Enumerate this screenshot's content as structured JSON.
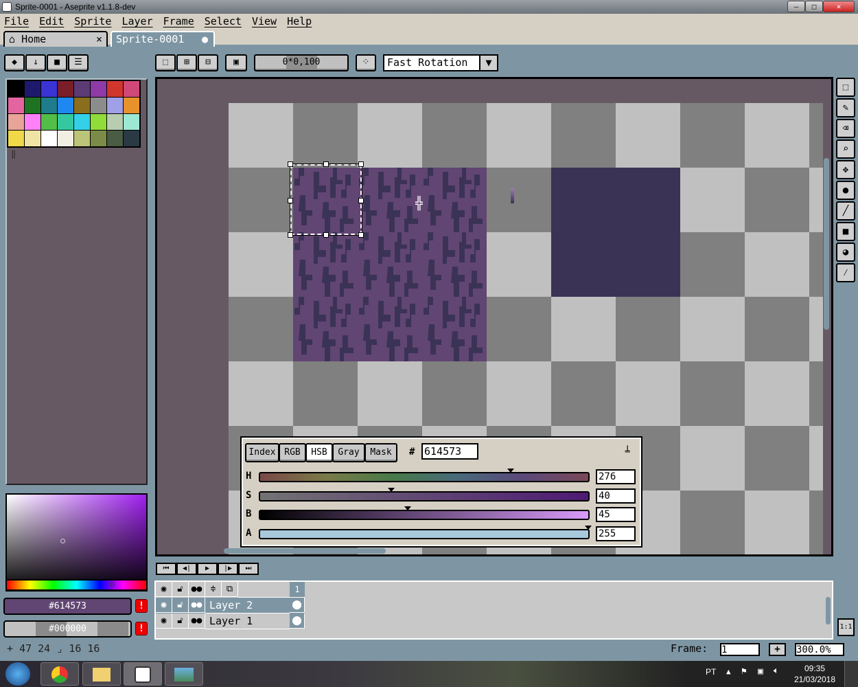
{
  "window": {
    "title": "Sprite-0001 - Aseprite v1.1.8-dev",
    "minimize": "–",
    "maximize": "□",
    "close": "✕"
  },
  "menu": [
    "File",
    "Edit",
    "Sprite",
    "Layer",
    "Frame",
    "Select",
    "View",
    "Help"
  ],
  "tabs": [
    {
      "label": "Home",
      "close": "×",
      "icon": "home-icon"
    },
    {
      "label": "Sprite-0001",
      "modified": "●"
    }
  ],
  "toolbar": {
    "opacity_label": "0*0,100",
    "rotation_algorithm": "Fast Rotation"
  },
  "palette": [
    "#000000",
    "#1d1a6e",
    "#3a34d4",
    "#7a1e2a",
    "#5c3a73",
    "#8f3aa6",
    "#d0362c",
    "#d04878",
    "#e464a0",
    "#1e7322",
    "#1e7c8c",
    "#1e88f0",
    "#8a6e1e",
    "#8c8c8c",
    "#a0a0e8",
    "#e8922c",
    "#e8a498",
    "#ff80f8",
    "#52be48",
    "#34c8a0",
    "#34d0e8",
    "#90dc38",
    "#b8ccb0",
    "#9ce8d4",
    "#f0d848",
    "#f0e4a4",
    "#ffffff",
    "#f2eee4",
    "#bcc478",
    "#7c8c48",
    "#4a5c44",
    "#2a3a44"
  ],
  "colors": {
    "foreground": "#614573",
    "background": "#000000",
    "accent_bg": "#7e96a4",
    "panel": "#665964",
    "dark_tile": "#3b3356"
  },
  "status": {
    "position": "47 24",
    "size": "16 16",
    "frame_label": "Frame:",
    "frame": "1",
    "add": "+",
    "zoom": "300.0%"
  },
  "color_panel": {
    "modes": [
      "Index",
      "RGB",
      "HSB",
      "Gray",
      "Mask"
    ],
    "active_mode": "HSB",
    "hash": "#",
    "hex": "614573",
    "sliders": [
      {
        "label": "H",
        "value": "276"
      },
      {
        "label": "S",
        "value": "40"
      },
      {
        "label": "B",
        "value": "45"
      },
      {
        "label": "A",
        "value": "255"
      }
    ]
  },
  "layers": {
    "frame_number": "1",
    "items": [
      {
        "name": "Layer 2",
        "selected": true
      },
      {
        "name": "Layer 1",
        "selected": false
      }
    ]
  },
  "zoom_button": "1:1",
  "taskbar": {
    "language": "PT",
    "time": "09:35",
    "date": "21/03/2018"
  }
}
